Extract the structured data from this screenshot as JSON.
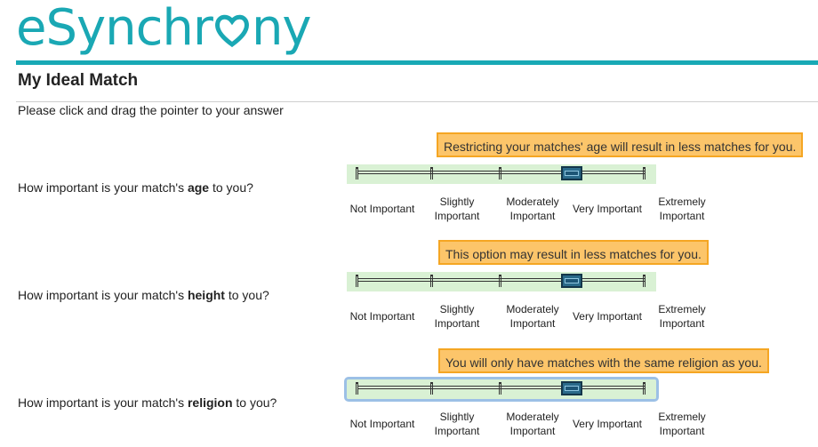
{
  "brand": {
    "logo_text_pre": "eSynchr",
    "logo_text_post": "ny",
    "color": "#1aa8b4"
  },
  "page": {
    "title": "My Ideal Match",
    "instructions": "Please click and drag the pointer to your answer"
  },
  "scale_labels": [
    "Not Important",
    "Slightly Important",
    "Moderately Important",
    "Very Important",
    "Extremely Important"
  ],
  "questions": [
    {
      "prefix": "How important is your match's ",
      "keyword": "age",
      "suffix": " to you?",
      "tooltip": "Restricting your matches' age will result in less matches for you.",
      "selected": "Very Important",
      "value_index": 3
    },
    {
      "prefix": "How important is your match's ",
      "keyword": "height",
      "suffix": " to you?",
      "tooltip": "This option may result in less matches for you.",
      "selected": "Very Important",
      "value_index": 3
    },
    {
      "prefix": "How important is your match's ",
      "keyword": "religion",
      "suffix": " to you?",
      "tooltip": "You will only have matches with the same religion as you.",
      "selected": "Very Important",
      "value_index": 3,
      "focused": true
    }
  ],
  "colors": {
    "accent": "#18a9b5",
    "tooltip_bg": "#fcc56a",
    "tooltip_border": "#f5a623",
    "slider_bg": "#d9f1d4",
    "handle": "#2a6a8a"
  }
}
